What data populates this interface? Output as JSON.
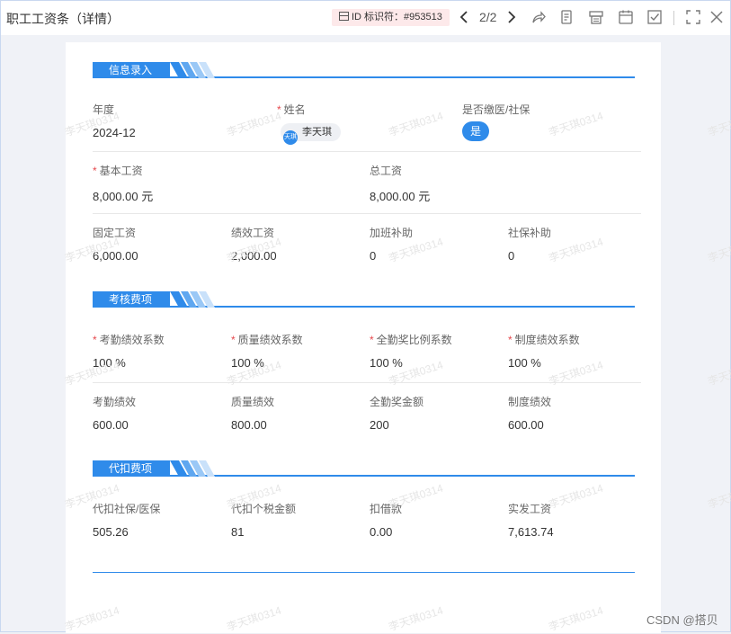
{
  "window": {
    "title": "职工工资条（详情）",
    "id_tag": "ID  标识符：#953513",
    "pager": "2/2"
  },
  "sections": {
    "info": "信息录入",
    "assess": "考核费项",
    "deduct": "代扣费项"
  },
  "info": {
    "year_label": "年度",
    "year_value": "2024-12",
    "name_label": "姓名",
    "name_value": "李天琪",
    "avatar_text": "天琪",
    "insured_label": "是否缴医/社保",
    "insured_value": "是",
    "base_label": "基本工资",
    "base_value": "8,000.00 元",
    "total_label": "总工资",
    "total_value": "8,000.00 元",
    "fixed_label": "固定工资",
    "fixed_value": "6,000.00",
    "perf_label": "绩效工资",
    "perf_value": "2,000.00",
    "overtime_label": "加班补助",
    "overtime_value": "0",
    "social_label": "社保补助",
    "social_value": "0"
  },
  "assess": {
    "att_coef_label": "考勤绩效系数",
    "att_coef_value": "100 %",
    "qual_coef_label": "质量绩效系数",
    "qual_coef_value": "100 %",
    "full_coef_label": "全勤奖比例系数",
    "full_coef_value": "100 %",
    "sys_coef_label": "制度绩效系数",
    "sys_coef_value": "100 %",
    "att_label": "考勤绩效",
    "att_value": "600.00",
    "qual_label": "质量绩效",
    "qual_value": "800.00",
    "full_label": "全勤奖金额",
    "full_value": "200",
    "sys_label": "制度绩效",
    "sys_value": "600.00"
  },
  "deduct": {
    "soc_label": "代扣社保/医保",
    "soc_value": "505.26",
    "tax_label": "代扣个税金额",
    "tax_value": "81",
    "borrow_label": "扣借款",
    "borrow_value": "0.00",
    "net_label": "实发工资",
    "net_value": "7,613.74"
  },
  "watermark": "李天琪0314",
  "footer": "CSDN @搭贝",
  "colors": {
    "accent": "#2f8bea",
    "required": "#e5484d",
    "id_tag_bg": "#fde9ea"
  }
}
